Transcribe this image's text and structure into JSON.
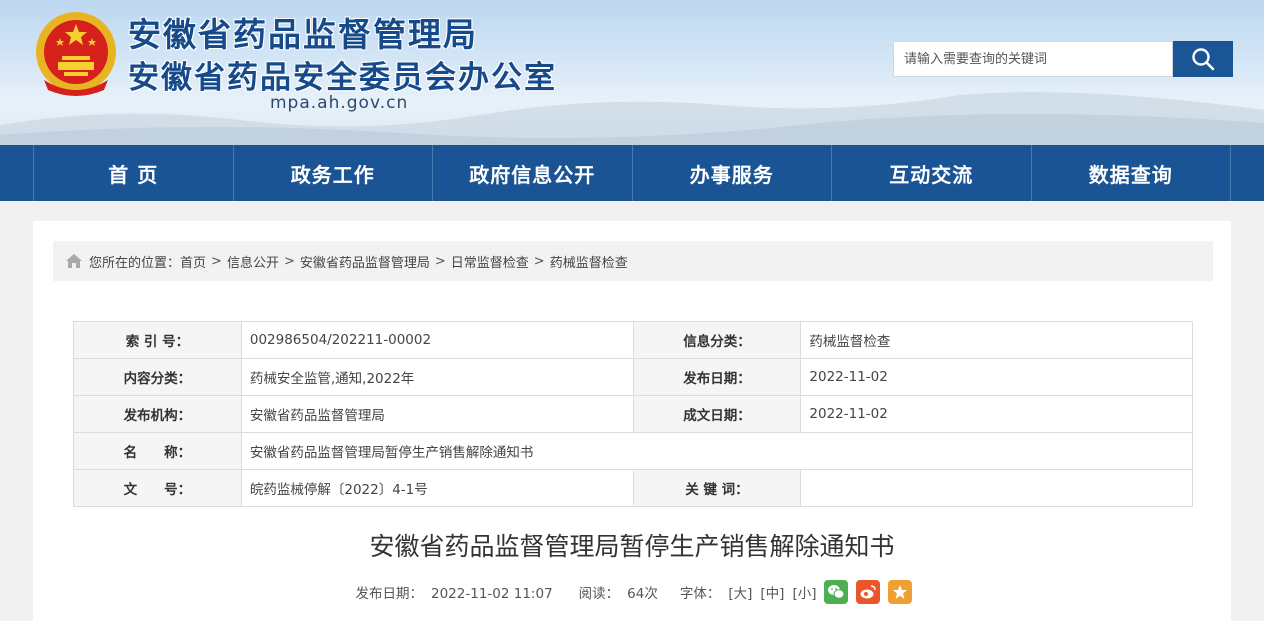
{
  "header": {
    "title": "安徽省药品监督管理局",
    "subtitle": "安徽省药品安全委员会办公室",
    "url": "mpa.ah.gov.cn",
    "search_placeholder": "请输入需要查询的关键词"
  },
  "nav": {
    "items": [
      "首 页",
      "政务工作",
      "政府信息公开",
      "办事服务",
      "互动交流",
      "数据查询"
    ]
  },
  "breadcrumb": {
    "prefix": "您所在的位置：",
    "items": [
      "首页",
      "信息公开",
      "安徽省药品监督管理局",
      "日常监督检查",
      "药械监督检查"
    ],
    "separator": ">"
  },
  "info_table": {
    "index_label": "索 引 号：",
    "index_value": "002986504/202211-00002",
    "category_label": "信息分类：",
    "category_value": "药械监督检查",
    "content_label": "内容分类：",
    "content_value": "药械安全监管,通知,2022年",
    "publish_date_label": "发布日期：",
    "publish_date_value": "2022-11-02",
    "org_label": "发布机构：",
    "org_value": "安徽省药品监督管理局",
    "created_date_label": "成文日期：",
    "created_date_value": "2022-11-02",
    "name_label": "名　　称：",
    "name_value": "安徽省药品监督管理局暂停生产销售解除通知书",
    "doc_no_label": "文　　号：",
    "doc_no_value": "皖药监械停解〔2022〕4-1号",
    "keywords_label": "关 键 词：",
    "keywords_value": ""
  },
  "article": {
    "title": "安徽省药品监督管理局暂停生产销售解除通知书",
    "publish_label": "发布日期：",
    "publish_value": "2022-11-02 11:07",
    "reads_label": "阅读：",
    "reads_value": "64次",
    "font_label": "字体：",
    "font_large": "[大]",
    "font_medium": "[中]",
    "font_small": "[小]"
  },
  "colors": {
    "nav_bg": "#1a5494",
    "title_blue": "#164a8a",
    "wechat": "#4caf50",
    "weibo": "#e8562a",
    "favorite": "#f0a030"
  }
}
